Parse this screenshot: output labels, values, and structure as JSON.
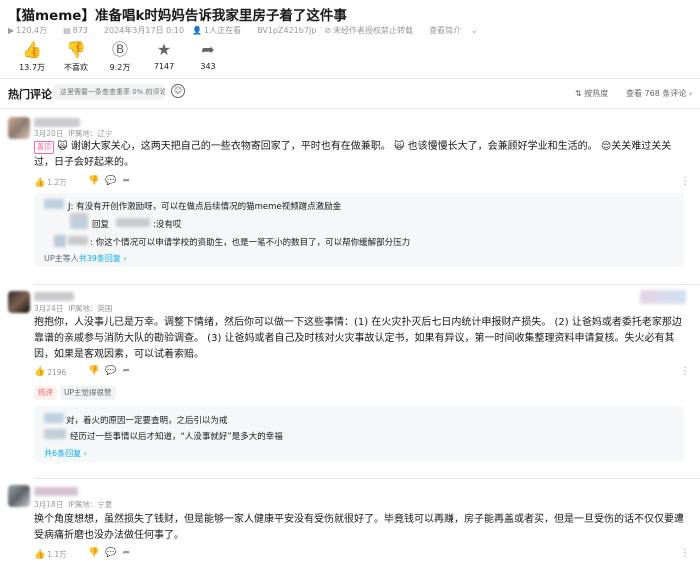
{
  "video": {
    "title": "【猫meme】准备唱k时妈妈告诉我家里房子着了这件事",
    "views": "120.4万",
    "danmaku": "873",
    "datetime": "2024年3月17日 0:10",
    "watching": "1人正在看",
    "bvid": "BV1pZ421b7Jp",
    "no_repost": "未经作者授权禁止转载",
    "intro": "查看简介"
  },
  "actions": [
    {
      "icon": "thumb-up-icon",
      "glyph": "👍",
      "count": "13.7万"
    },
    {
      "icon": "thumb-down-icon",
      "glyph": "👎",
      "count": "不喜欢"
    },
    {
      "icon": "coin-icon",
      "glyph": "Ⓑ",
      "count": "9.2万"
    },
    {
      "icon": "star-icon",
      "glyph": "★",
      "count": "7147"
    },
    {
      "icon": "share-icon",
      "glyph": "➦",
      "count": "343"
    }
  ],
  "comments_header": {
    "title": "热门评论",
    "placeholder": "这里需要一条查查重率 0% 的评论",
    "sort_label": "按热度",
    "view_all": "查看 768 条评论 ›"
  },
  "comments": [
    {
      "date": "3月20日",
      "location": "IP属地：辽宁",
      "badge": "置顶",
      "text_a": "谢谢大家关心，这两天把自己的一些衣物寄回家了，平时也有在做兼职。",
      "text_b": "也该慢慢长大了，会兼顾好学业和生活的。",
      "text_c": "关关难过关关过，日子会好起来的。",
      "likes": "1.2万",
      "replies": [
        {
          "text": "J: 有没有开创作激励呀，可以在做点后续情况的猫meme视频蹭点激励金"
        },
        {
          "reply_label": "回复",
          "text": ":没有哎"
        },
        {
          "text": ": 你这个情况可以申请学校的资助生，也是一笔不小的数目了，可以帮你缓解部分压力"
        }
      ],
      "reply_summary_prefix": "UP主等人",
      "reply_summary_link": "共39条回复 ›"
    },
    {
      "date": "3月24日",
      "location": "IP属地：英国",
      "text": "抱抱你，人没事儿已是万幸。调整下情绪，然后你可以做一下这些事情：(1) 在火灾扑灭后七日内统计申报财产损失。 (2) 让爸妈或者委托老家那边靠谱的亲戚参与消防大队的勘验调查。 (3) 让爸妈或者自己及时核对火灾事故认定书，如果有异议，第一时间收集整理资料申请复核。失火必有其因，如果是客观因素，可以试着索赔。",
      "likes": "2196",
      "tag_hot": "热评",
      "tag_up": "UP主觉得很赞",
      "replies": [
        {
          "text": "对，着火的原因一定要查明，之后引以为戒"
        },
        {
          "text": "经历过一些事情以后才知道，“人没事就好”是多大的幸福"
        }
      ],
      "reply_summary_link": "共6条回复 ›"
    },
    {
      "date": "3月18日",
      "location": "IP属地：宁夏",
      "text": "换个角度想想，虽然损失了钱财，但是能够一家人健康平安没有受伤就很好了。毕竟钱可以再赚，房子能再盖或者买，但是一旦受伤的话不仅仅要遭受病痛折磨也没办法做任何事了。",
      "likes": "1.1万"
    }
  ],
  "colors": {
    "accent": "#00aeec",
    "pin_badge": "#ff6699",
    "text": "#18191c",
    "muted": "#9499a0"
  }
}
